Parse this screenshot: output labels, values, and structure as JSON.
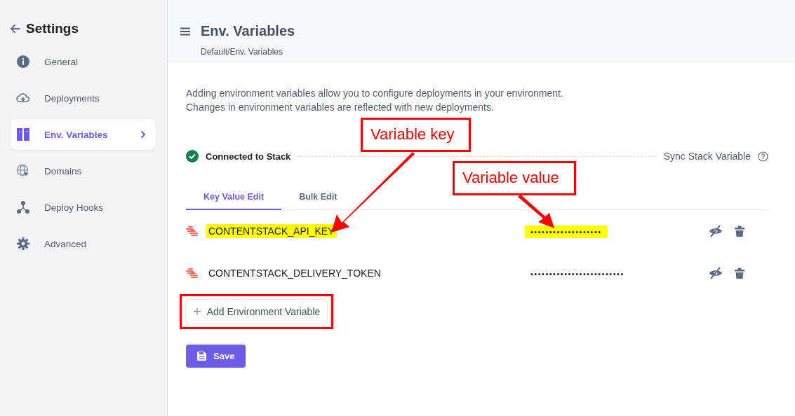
{
  "sidebar": {
    "title": "Settings",
    "items": [
      {
        "label": "General",
        "selected": false
      },
      {
        "label": "Deployments",
        "selected": false
      },
      {
        "label": "Env. Variables",
        "selected": true
      },
      {
        "label": "Domains",
        "selected": false
      },
      {
        "label": "Deploy Hooks",
        "selected": false
      },
      {
        "label": "Advanced",
        "selected": false
      }
    ]
  },
  "header": {
    "title": "Env. Variables",
    "breadcrumb": [
      "Default",
      "/",
      "Env. Variables"
    ]
  },
  "description": [
    "Adding environment variables allow you to configure deployments in your environment.",
    "Changes in environment variables are reflected with new deployments."
  ],
  "stack": {
    "status": "Connected to Stack",
    "connected": true,
    "sync_label": "Sync Stack Variable"
  },
  "tabs": [
    {
      "label": "Key Value Edit",
      "selected": true
    },
    {
      "label": "Bulk Edit",
      "selected": false
    }
  ],
  "variables": [
    {
      "key": "CONTENTSTACK_API_KEY",
      "value": "•••••••••••••••••••",
      "highlighted": true
    },
    {
      "key": "CONTENTSTACK_DELIVERY_TOKEN",
      "value": "•••••••••••••••••••••••••",
      "highlighted": false
    }
  ],
  "add_button": {
    "icon": "+",
    "label": "Add Environment Variable",
    "framed": true
  },
  "save_button": {
    "label": "Save"
  },
  "callouts": [
    {
      "text": "Variable key"
    },
    {
      "text": "Variable value"
    }
  ]
}
